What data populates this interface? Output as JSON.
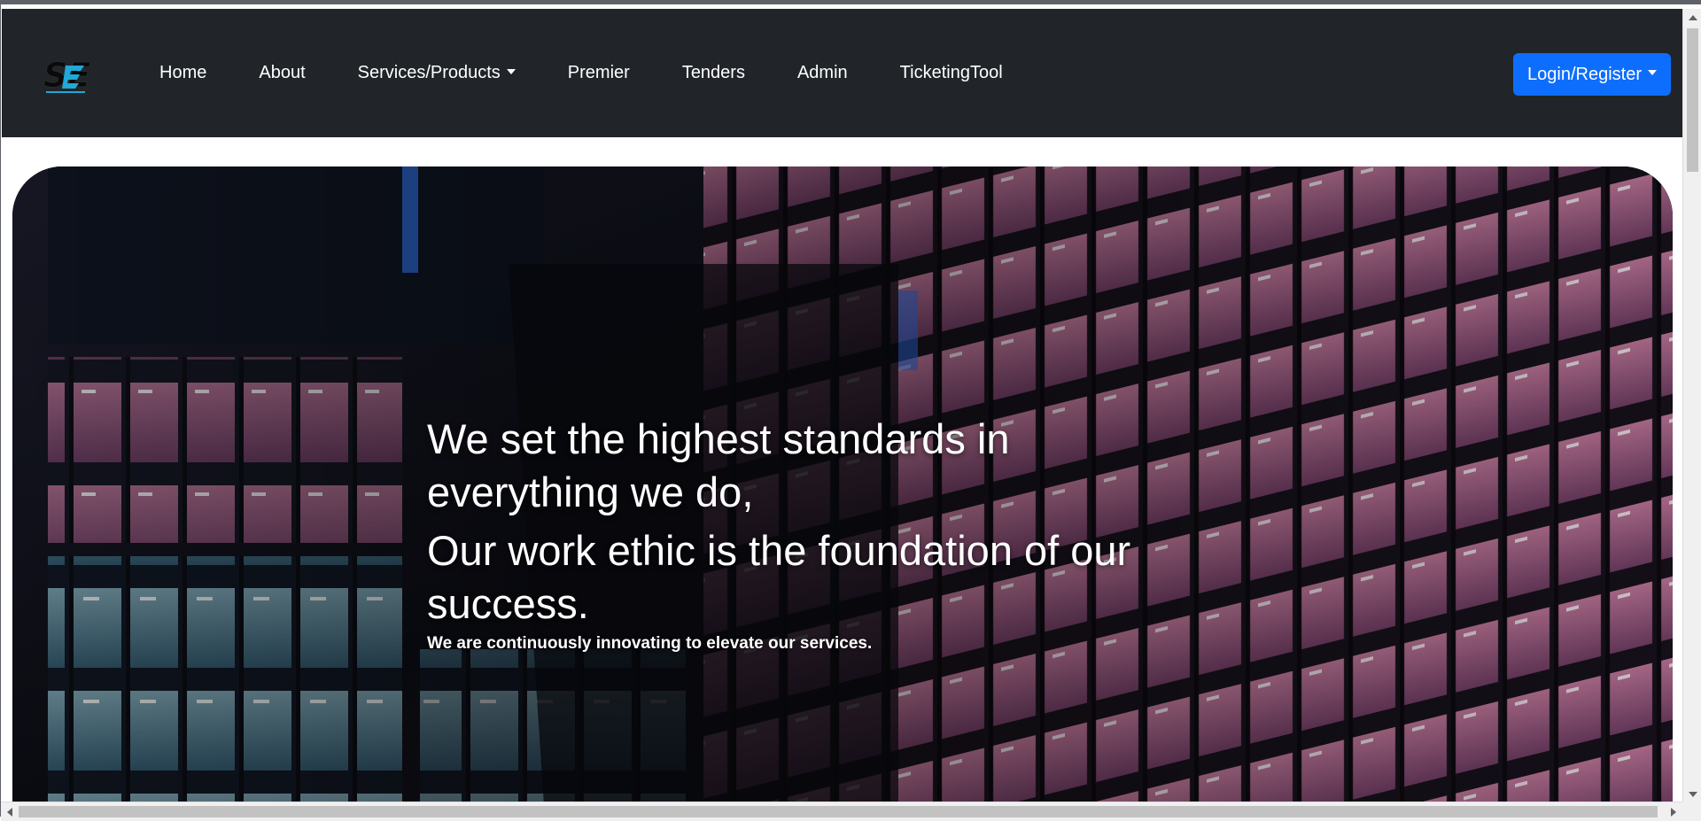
{
  "colors": {
    "navbar_bg": "#212529",
    "login_button_bg": "#0d6efd",
    "hero_text": "#ffffff"
  },
  "logo": {
    "icon": "se-logo-icon",
    "text": "SE"
  },
  "nav": {
    "items": [
      {
        "label": "Home",
        "dropdown": false
      },
      {
        "label": "About",
        "dropdown": false
      },
      {
        "label": "Services/Products",
        "dropdown": true
      },
      {
        "label": "Premier",
        "dropdown": false
      },
      {
        "label": "Tenders",
        "dropdown": false
      },
      {
        "label": "Admin",
        "dropdown": false
      },
      {
        "label": "TicketingTool",
        "dropdown": false
      }
    ],
    "login_label": "Login/Register"
  },
  "hero": {
    "headline": "We set the highest standards in everything we do,",
    "subheadline": "Our work ethic is the foundation of our success.",
    "tagline": "We are continuously innovating to elevate our services."
  }
}
